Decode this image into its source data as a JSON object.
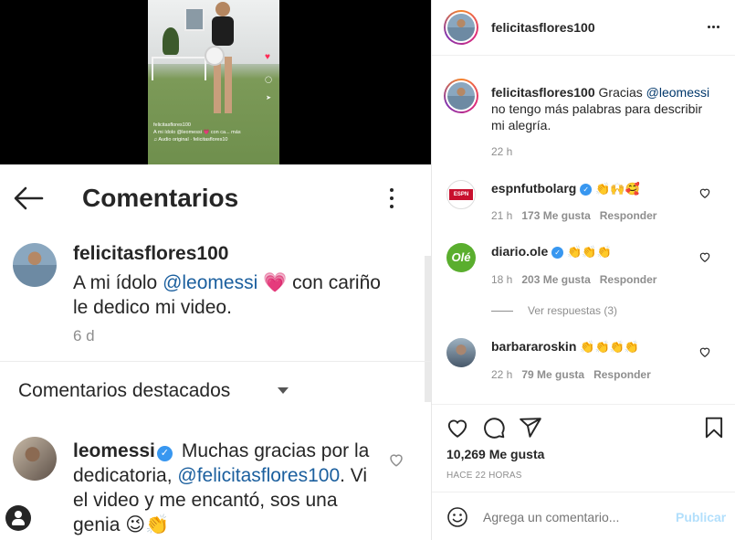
{
  "left_shot": {
    "video": {
      "caption_user": "felicitasflores100",
      "caption_line": "A mi ídolo @leomessi 💗 con ca... más",
      "audio_line": "♫ Audio original · felicitasflores10"
    },
    "header": {
      "title": "Comentarios"
    },
    "original_comment": {
      "username": "felicitasflores100",
      "text_before": "A mi ídolo ",
      "mention": "@leomessi",
      "text_after": " 💗 con cariño le dedico mi video.",
      "age": "6 d"
    },
    "featured_label": "Comentarios destacados",
    "reply": {
      "username": "leomessi",
      "text_before": "Muchas gracias por la dedicatoria, ",
      "mention": "@felicitasflores100",
      "text_after": ". Vi el video y me encantó, sos una genia 😉👏"
    }
  },
  "panel": {
    "header": {
      "username": "felicitasflores100"
    },
    "caption": {
      "username": "felicitasflores100",
      "text_before": "Gracias ",
      "mention": "@leomessi",
      "text_after": " no tengo más palabras para describir mi alegría.",
      "age": "22 h"
    },
    "comments": [
      {
        "username": "espnfutbolarg",
        "text": "👏🙌🥰",
        "age": "21 h",
        "likes": "173 Me gusta",
        "reply": "Responder"
      },
      {
        "username": "diario.ole",
        "text": "👏👏👏",
        "age": "18 h",
        "likes": "203 Me gusta",
        "reply": "Responder",
        "view_replies": "Ver respuestas (3)"
      },
      {
        "username": "barbararoskin",
        "text": "👏👏👏👏",
        "age": "22 h",
        "likes": "79 Me gusta",
        "reply": "Responder"
      }
    ],
    "likes_count": "10,269 Me gusta",
    "time_ago": "HACE 22 HORAS",
    "add_comment": {
      "placeholder": "Agrega un comentario...",
      "publish": "Publicar"
    },
    "avatar_labels": {
      "espn": "ESPN",
      "ole": "Olé"
    }
  }
}
